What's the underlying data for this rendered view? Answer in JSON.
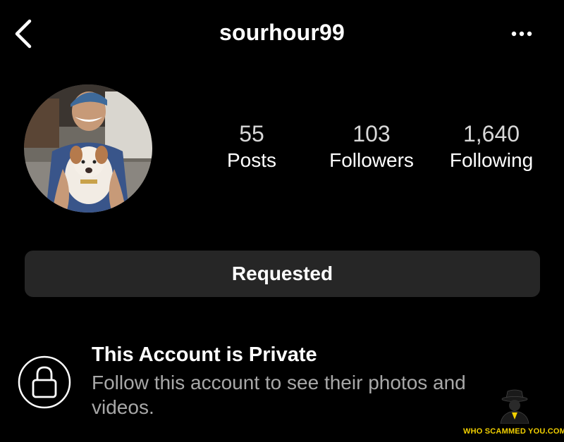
{
  "header": {
    "username": "sourhour99",
    "back_icon": "chevron-left-icon",
    "more_icon": "more-horizontal-icon"
  },
  "profile": {
    "avatar_alt": "profile photo",
    "stats": [
      {
        "value": "55",
        "label": "Posts"
      },
      {
        "value": "103",
        "label": "Followers"
      },
      {
        "value": "1,640",
        "label": "Following"
      }
    ]
  },
  "actions": {
    "requested_label": "Requested"
  },
  "private_notice": {
    "icon": "lock-icon",
    "title": "This Account is Private",
    "description": "Follow this account to see their photos and videos."
  },
  "watermark": {
    "text": "WHO SCAMMED YOU.COM"
  },
  "colors": {
    "background": "#000000",
    "button_bg": "#262626",
    "secondary_text": "#a8a8a8",
    "stat_number": "#d8d8d8",
    "watermark_accent": "#f2d000"
  }
}
